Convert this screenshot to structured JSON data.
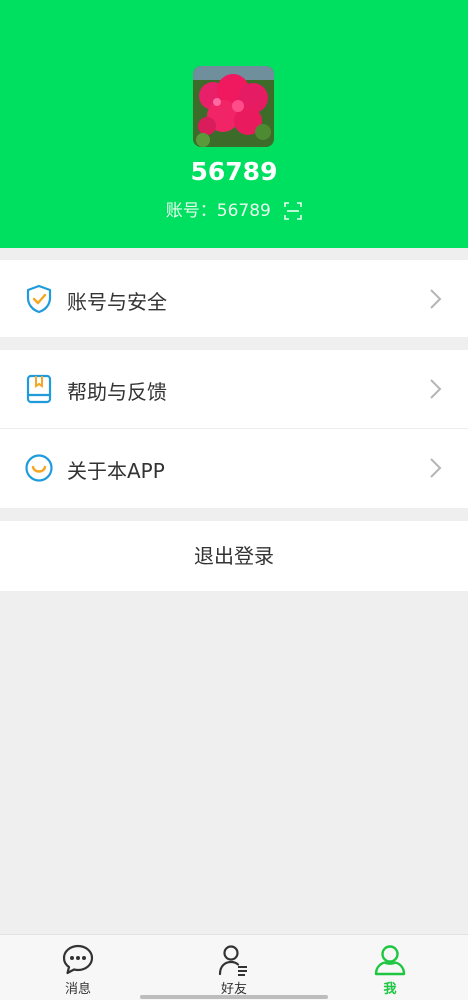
{
  "profile": {
    "username": "56789",
    "account_label": "账号：",
    "account_id": "56789"
  },
  "menu": {
    "security": "账号与安全",
    "help": "帮助与反馈",
    "about": "关于本APP",
    "logout": "退出登录"
  },
  "bottom_nav": {
    "messages": "消息",
    "friends": "好友",
    "me": "我"
  },
  "colors": {
    "header": "#00e060",
    "active_tab": "#1ec641",
    "icon_blue": "#1f9bdc"
  }
}
